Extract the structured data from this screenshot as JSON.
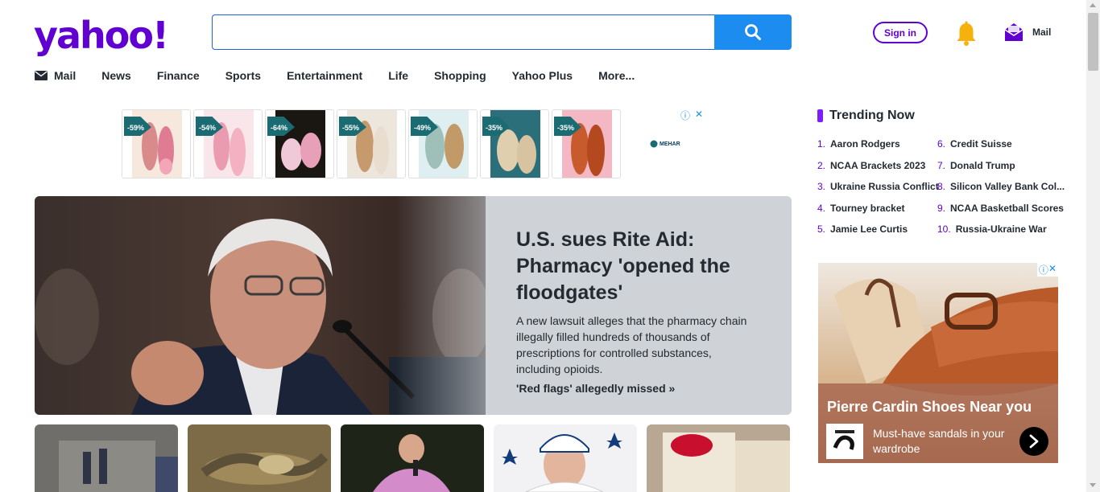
{
  "header": {
    "logo_text": "yahoo!",
    "search": {
      "value": "",
      "placeholder": ""
    },
    "signin_label": "Sign in",
    "mail_label": "Mail"
  },
  "nav": {
    "items": [
      {
        "label": "Mail",
        "icon": "mail-icon"
      },
      {
        "label": "News"
      },
      {
        "label": "Finance"
      },
      {
        "label": "Sports"
      },
      {
        "label": "Entertainment"
      },
      {
        "label": "Life"
      },
      {
        "label": "Shopping"
      },
      {
        "label": "Yahoo Plus"
      },
      {
        "label": "More..."
      }
    ]
  },
  "ad_strip": {
    "tiles": [
      {
        "discount": "-59%"
      },
      {
        "discount": "-54%"
      },
      {
        "discount": "-64%"
      },
      {
        "discount": "-55%"
      },
      {
        "discount": "-49%"
      },
      {
        "discount": "-35%"
      },
      {
        "discount": "-35%"
      }
    ],
    "brand": "MEHAR"
  },
  "hero": {
    "title": "U.S. sues Rite Aid: Pharmacy 'opened the floodgates'",
    "summary": "A new lawsuit alleges that the pharmacy chain illegally filled hundreds of thousands of prescriptions for controlled substances, including opioids.",
    "link": "'Red flags' allegedly missed »"
  },
  "trending": {
    "title": "Trending Now",
    "accent": "#7e1fff",
    "left": [
      {
        "num": "1.",
        "label": "Aaron Rodgers"
      },
      {
        "num": "2.",
        "label": "NCAA Brackets 2023"
      },
      {
        "num": "3.",
        "label": "Ukraine Russia Conflict"
      },
      {
        "num": "4.",
        "label": "Tourney bracket"
      },
      {
        "num": "5.",
        "label": "Jamie Lee Curtis"
      }
    ],
    "right": [
      {
        "num": "6.",
        "label": "Credit Suisse"
      },
      {
        "num": "7.",
        "label": "Donald Trump"
      },
      {
        "num": "8.",
        "label": "Silicon Valley Bank Col..."
      },
      {
        "num": "9.",
        "label": "NCAA Basketball Scores"
      },
      {
        "num": "10.",
        "label": "Russia-Ukraine War"
      }
    ]
  },
  "right_ad": {
    "title": "Pierre Cardin Shoes Near you",
    "subtitle": "Must-have sandals in your wardrobe"
  },
  "colors": {
    "brand": "#6001d2",
    "search_button": "#1d8cf0",
    "bell": "#f6b20c"
  }
}
